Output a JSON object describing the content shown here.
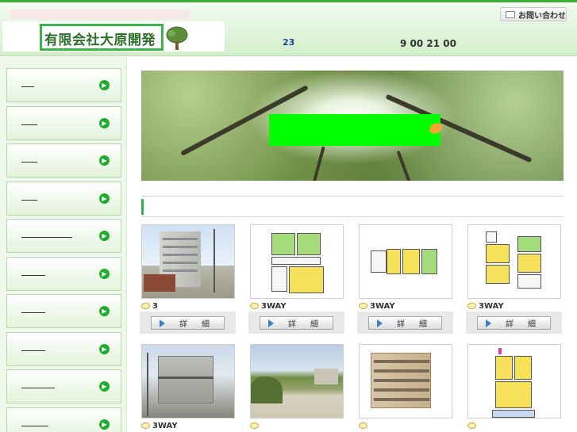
{
  "header": {
    "company_name": "有限会社大原開発",
    "date_number": "23",
    "hours_text": "9 00 21 00",
    "contact_label": "お問い合わせ"
  },
  "colors": {
    "brand_green": "#39b54a",
    "banner_green": "#00ff00",
    "nav_arrow": "#1cad2c",
    "header_bg": "#d2efc9"
  },
  "sidebar": {
    "items": [
      {
        "label": "",
        "icon": "arrow-right-icon"
      },
      {
        "label": "",
        "icon": "arrow-right-icon"
      },
      {
        "label": "",
        "icon": "arrow-right-icon"
      },
      {
        "label": "",
        "icon": "arrow-right-icon"
      },
      {
        "label": "",
        "icon": "arrow-right-icon"
      },
      {
        "label": "",
        "icon": "arrow-right-icon"
      },
      {
        "label": "",
        "icon": "arrow-right-icon"
      },
      {
        "label": "",
        "icon": "arrow-right-icon"
      },
      {
        "label": "",
        "icon": "arrow-right-icon"
      },
      {
        "label": "",
        "icon": "arrow-right-icon"
      }
    ]
  },
  "main": {
    "detail_label_a": "詳",
    "detail_label_b": "細",
    "listings_row1": [
      {
        "caption": "3",
        "image": "apartment-building-photo"
      },
      {
        "caption": "3WAY",
        "image": "floor-plan"
      },
      {
        "caption": "3WAY",
        "image": "floor-plan"
      },
      {
        "caption": "3WAY",
        "image": "floor-plan"
      }
    ],
    "listings_row2": [
      {
        "caption": "3WAY",
        "image": "two-story-apartment-photo"
      },
      {
        "caption": "",
        "image": "vacant-lot-photo"
      },
      {
        "caption": "",
        "image": "building-rendering"
      },
      {
        "caption": "",
        "image": "floor-plan"
      }
    ]
  }
}
